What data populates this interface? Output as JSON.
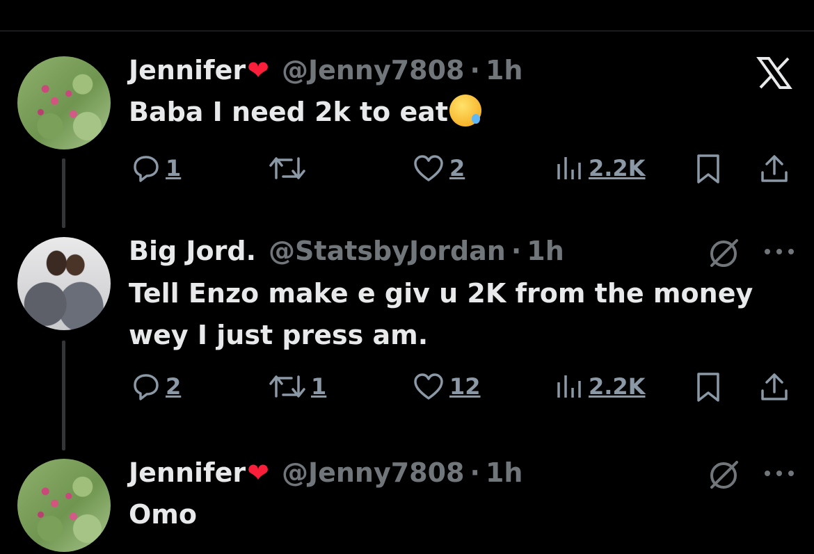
{
  "close_label": "X",
  "tweets": [
    {
      "name": "Jennifer",
      "handle": "@Jenny7808",
      "dot": "·",
      "time": "1h",
      "text_lines": [
        "Baba I need 2k to eat"
      ],
      "replies": "1",
      "retweets": "",
      "likes": "2",
      "views": "2.2K"
    },
    {
      "name": "Big Jord.",
      "handle": "@StatsbyJordan",
      "dot": "·",
      "time": "1h",
      "text_lines": [
        "Tell Enzo make e giv u 2K from the money",
        "wey I just press am."
      ],
      "replies": "2",
      "retweets": "1",
      "likes": "12",
      "views": "2.2K"
    },
    {
      "name": "Jennifer",
      "handle": "@Jenny7808",
      "dot": "·",
      "time": "1h",
      "text_lines": [
        "Omo"
      ]
    }
  ],
  "colors": {
    "background": "#000000",
    "text": "#e7e9ea",
    "muted": "#71767b",
    "icon": "#8b98a5",
    "heart": "#f91e3a",
    "thread_line": "#333639"
  }
}
